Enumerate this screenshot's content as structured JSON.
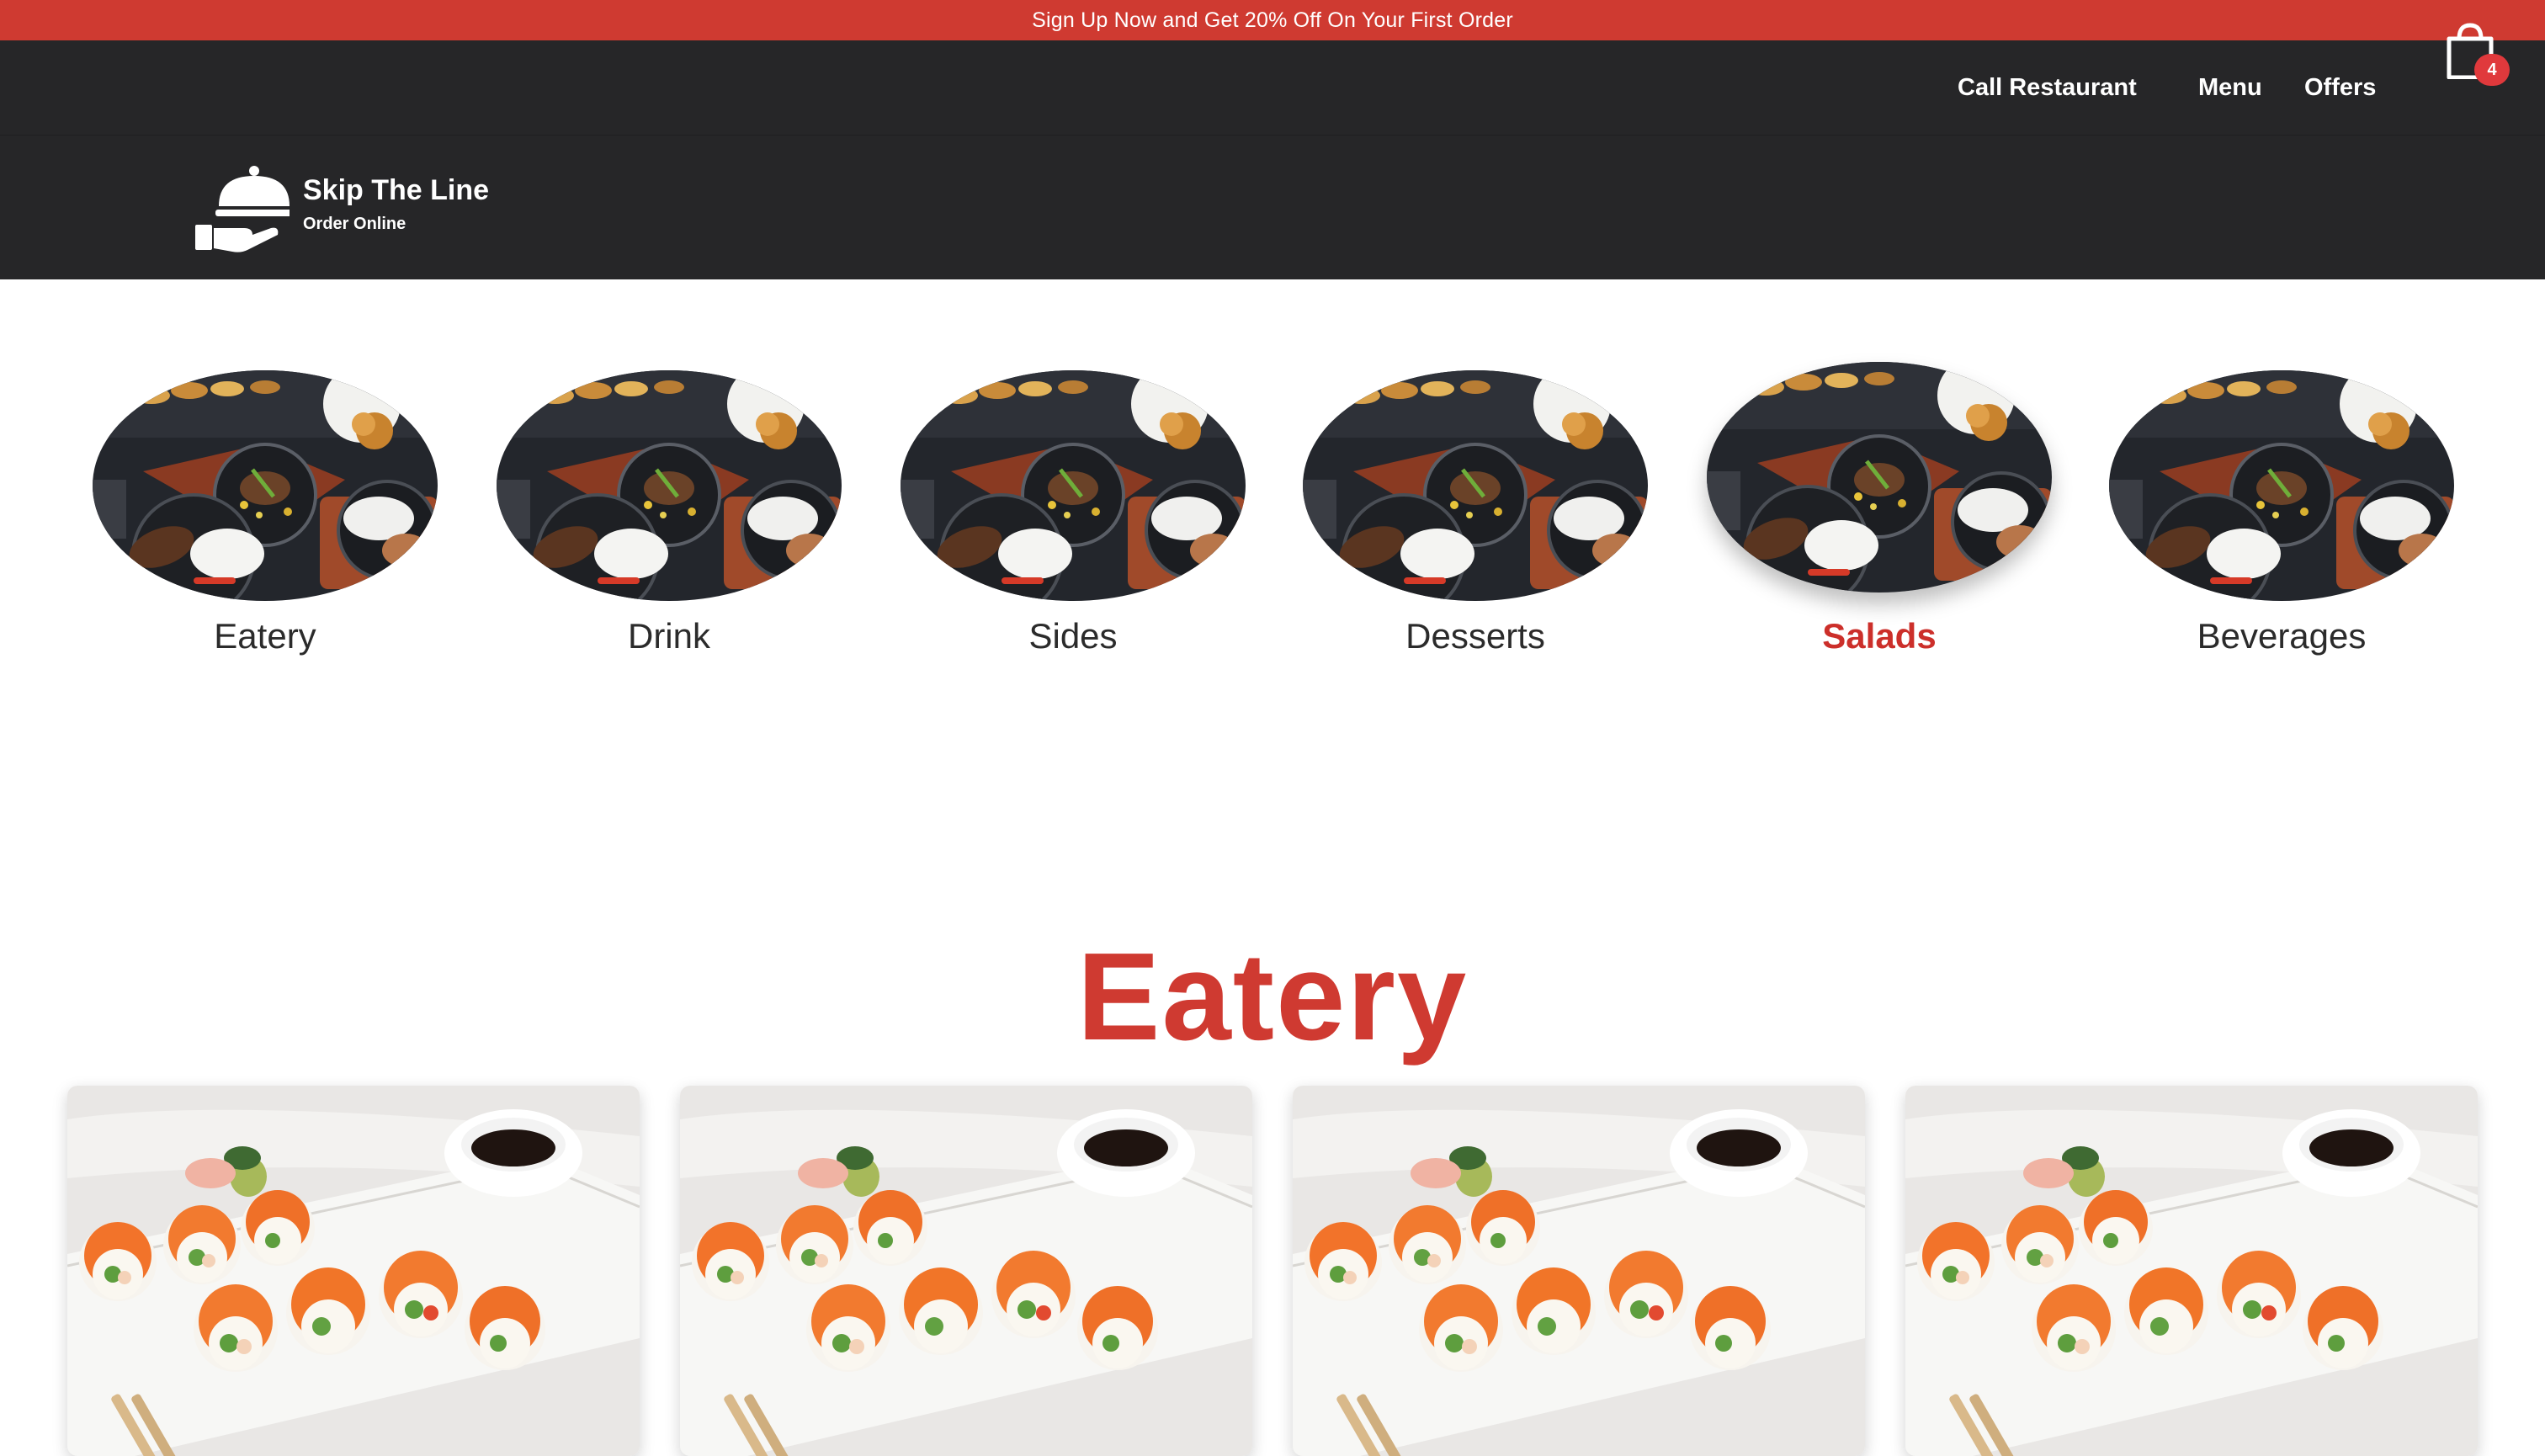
{
  "promo": {
    "text": "Sign Up Now and Get 20% Off On Your First Order"
  },
  "nav": {
    "call": "Call Restaurant",
    "menu": "Menu",
    "offers": "Offers",
    "cart_icon": "shopping-bag-icon",
    "cart_count": "4"
  },
  "brand": {
    "logo_icon": "serving-cloche-icon",
    "name": "Skip The Line",
    "tagline": "Order Online"
  },
  "categories": [
    {
      "label": "Eatery"
    },
    {
      "label": "Drink"
    },
    {
      "label": "Sides"
    },
    {
      "label": "Desserts"
    },
    {
      "label": "Salads",
      "active": true
    },
    {
      "label": "Beverages"
    }
  ],
  "section": {
    "title": "Eatery"
  },
  "colors": {
    "brand_red": "#cf3a31",
    "header_dark": "#262628",
    "badge": "#e0393c"
  }
}
